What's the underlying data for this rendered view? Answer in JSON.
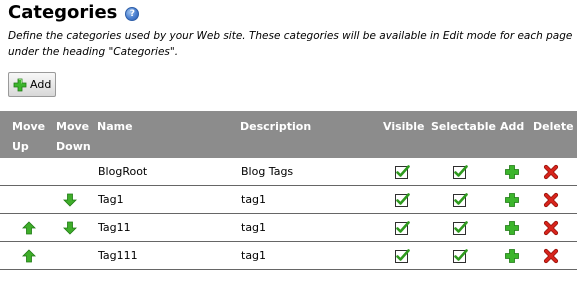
{
  "page": {
    "title": "Categories",
    "help_icon": "help-question-icon",
    "description": "Define the categories used by your Web site. These categories will be available in Edit mode for each page under the heading \"Categories\"."
  },
  "toolbar": {
    "add_label": "Add",
    "add_icon": "plus-icon"
  },
  "table": {
    "headers": {
      "move_up": "Move Up",
      "move_up_l1": "Move",
      "move_up_l2": "Up",
      "move_down_l1": "Move",
      "move_down_l2": "Down",
      "name": "Name",
      "description": "Description",
      "visible": "Visible",
      "selectable": "Selectable",
      "add": "Add",
      "delete": "Delete"
    },
    "rows": [
      {
        "name": "BlogRoot",
        "description": "Blog Tags",
        "move_up": false,
        "move_down": false,
        "visible": true,
        "selectable": true
      },
      {
        "name": "Tag1",
        "description": "tag1",
        "move_up": false,
        "move_down": true,
        "visible": true,
        "selectable": true
      },
      {
        "name": "Tag11",
        "description": "tag1",
        "move_up": true,
        "move_down": true,
        "visible": true,
        "selectable": true
      },
      {
        "name": "Tag111",
        "description": "tag1",
        "move_up": true,
        "move_down": false,
        "visible": true,
        "selectable": true
      }
    ]
  },
  "colors": {
    "header_bg": "#8c8c8c",
    "arrow_green": "#3fae2a",
    "check_green": "#2e9a1e",
    "delete_red": "#d8241c",
    "plus_green": "#3cb52c"
  }
}
